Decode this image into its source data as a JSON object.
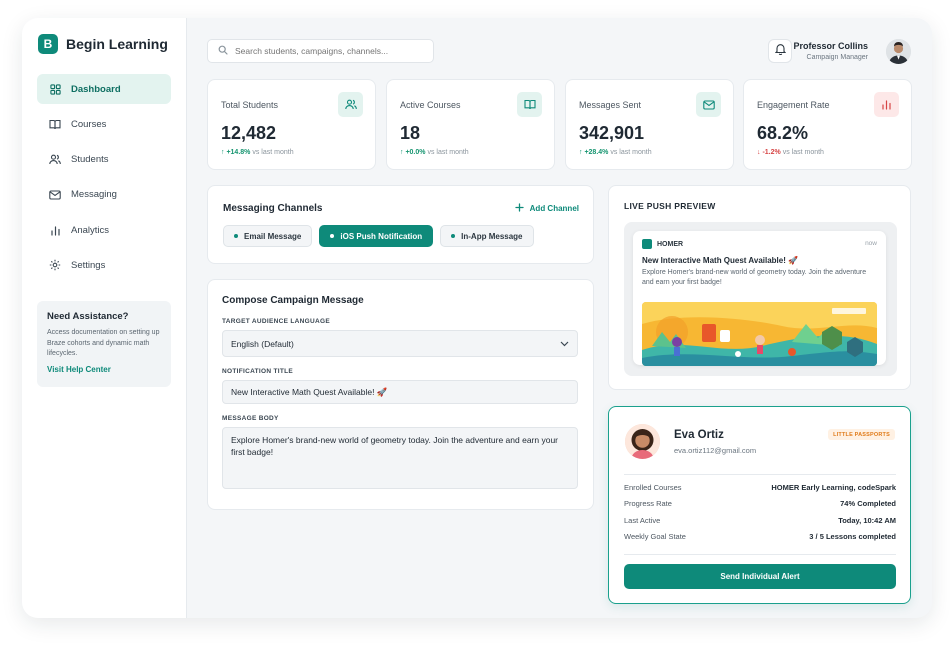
{
  "brand": {
    "logo_letter": "B",
    "name": "Begin Learning"
  },
  "sidebar": {
    "items": [
      {
        "label": "Dashboard",
        "icon": "dashboard-icon",
        "active": true
      },
      {
        "label": "Courses",
        "icon": "book-icon",
        "active": false
      },
      {
        "label": "Students",
        "icon": "users-icon",
        "active": false
      },
      {
        "label": "Messaging",
        "icon": "mail-icon",
        "active": false
      },
      {
        "label": "Analytics",
        "icon": "bar-chart-icon",
        "active": false
      },
      {
        "label": "Settings",
        "icon": "gear-icon",
        "active": false
      }
    ],
    "assist": {
      "title": "Need Assistance?",
      "text": "Access documentation on setting up Braze cohorts and dynamic math lifecycles.",
      "link": "Visit Help Center"
    }
  },
  "header": {
    "search_placeholder": "Search students, campaigns, channels...",
    "user_name": "Professor Collins",
    "user_role": "Campaign Manager"
  },
  "stats": [
    {
      "label": "Total Students",
      "value": "12,482",
      "delta": "+14.8%",
      "delta_suffix": "vs last month",
      "trend": "up",
      "icon": "users-icon",
      "accent": "#e3f3ef"
    },
    {
      "label": "Active Courses",
      "value": "18",
      "delta": "+0.0%",
      "delta_suffix": "vs last month",
      "trend": "up",
      "icon": "book-icon",
      "accent": "#e3f3ef"
    },
    {
      "label": "Messages Sent",
      "value": "342,901",
      "delta": "+28.4%",
      "delta_suffix": "vs last month",
      "trend": "up",
      "icon": "mail-icon",
      "accent": "#e3f3ef"
    },
    {
      "label": "Engagement Rate",
      "value": "68.2%",
      "delta": "-1.2%",
      "delta_suffix": "vs last month",
      "trend": "down",
      "icon": "bar-chart-icon",
      "accent": "#fde8e8"
    }
  ],
  "channels": {
    "title": "Messaging Channels",
    "add_label": "Add Channel",
    "chips": [
      {
        "label": "Email Message",
        "active": false
      },
      {
        "label": "iOS Push Notification",
        "active": true
      },
      {
        "label": "In-App Message",
        "active": false
      }
    ]
  },
  "compose": {
    "title": "Compose Campaign Message",
    "language_label": "TARGET AUDIENCE LANGUAGE",
    "language_value": "English (Default)",
    "title_label": "NOTIFICATION TITLE",
    "title_value": "New Interactive Math Quest Available! 🚀",
    "body_label": "MESSAGE BODY",
    "body_value": "Explore Homer's brand-new world of geometry today. Join the adventure and earn your first badge!"
  },
  "preview": {
    "title": "LIVE PUSH PREVIEW",
    "app_name": "HOMER",
    "time": "now",
    "push_title": "New Interactive Math Quest Available! 🚀",
    "push_body": "Explore Homer's brand-new world of geometry today. Join the adventure and earn your first badge!"
  },
  "student": {
    "name": "Eva Ortiz",
    "email": "eva.ortiz112@gmail.com",
    "badge": "LITTLE PASSPORTS",
    "rows": [
      {
        "key": "Enrolled Courses",
        "value": "HOMER Early Learning, codeSpark"
      },
      {
        "key": "Progress Rate",
        "value": "74% Completed"
      },
      {
        "key": "Last Active",
        "value": "Today, 10:42 AM"
      },
      {
        "key": "Weekly Goal State",
        "value": "3 / 5 Lessons completed"
      }
    ],
    "button": "Send Individual Alert"
  },
  "colors": {
    "accent": "#0e8a7a",
    "danger": "#d64545",
    "badge": "#e07b1a"
  }
}
